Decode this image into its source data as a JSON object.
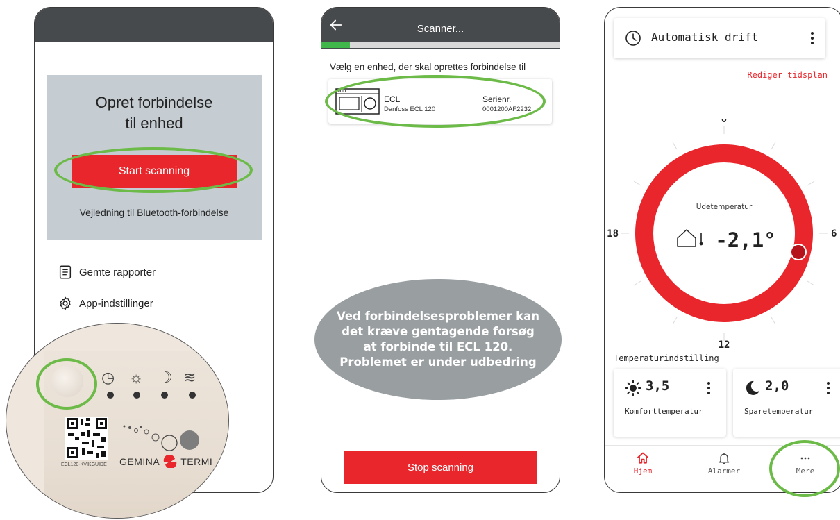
{
  "phone1": {
    "panel_title_line1": "Opret forbindelse",
    "panel_title_line2": "til enhed",
    "start_button": "Start scanning",
    "bluetooth_guide": "Vejledning til Bluetooth-forbindelse",
    "menu": [
      {
        "label": "Gemte rapporter",
        "icon": "report-icon"
      },
      {
        "label": "App-indstillinger",
        "icon": "gear-icon"
      }
    ],
    "device_closeup": {
      "caption": "ECL120-KVIKGUIDE",
      "brand": "GEMINA",
      "brand_partial": "TERMI"
    }
  },
  "phone2": {
    "title": "Scanner...",
    "progress": 0.12,
    "instruction": "Vælg en enhed, der skal oprettes forbindelse til",
    "device": {
      "name": "ECL",
      "model": "Danfoss ECL 120",
      "serial_label": "Serienr.",
      "serial_value": "0001200AF2232"
    },
    "stop_button": "Stop scanning"
  },
  "note": {
    "line1": "Ved forbindelsesproblemer kan",
    "line2": "det kræve gentagende forsøg",
    "line3": "at forbinde til ECL 120.",
    "line4": "Problemet er under udbedring"
  },
  "phone3": {
    "mode_label": "Automatisk drift",
    "edit_schedule": "Rediger tidsplan",
    "dial": {
      "label_top": "0",
      "label_right": "6",
      "label_bottom": "12",
      "label_left": "18",
      "center_label": "Udetemperatur",
      "center_value": "-2,1°"
    },
    "section_title": "Temperaturindstilling",
    "comfort": {
      "value": "3,5",
      "label": "Komforttemperatur",
      "icon": "sun-icon"
    },
    "saving": {
      "value": "2,0",
      "label": "Sparetemperatur",
      "icon": "moon-icon"
    },
    "tabs": [
      {
        "label": "Hjem",
        "icon": "home-icon",
        "active": true
      },
      {
        "label": "Alarmer",
        "icon": "bell-icon",
        "active": false
      },
      {
        "label": "Mere",
        "icon": "more-icon",
        "active": false
      }
    ]
  },
  "colors": {
    "accent_red": "#e8262b",
    "header_gray": "#474a4c",
    "panel_gray": "#c5cdd3",
    "highlight_green": "#6cba47",
    "progress_green": "#3fb74b"
  }
}
